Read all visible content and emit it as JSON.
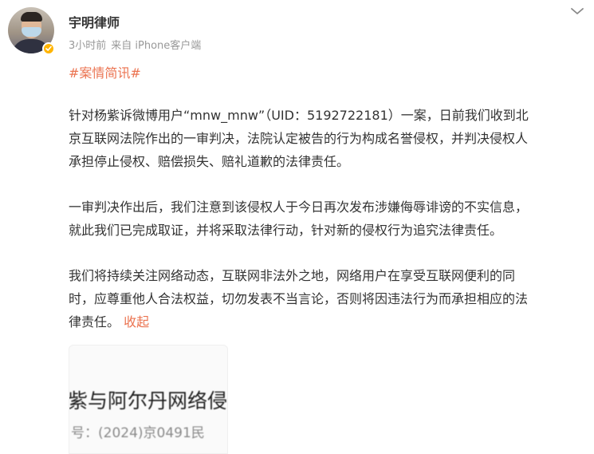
{
  "post": {
    "author": {
      "name": "宇明律师",
      "avatar_icon": "avatar",
      "verified_icon": "verified-badge-icon",
      "verified_color": "#ffb400"
    },
    "meta": {
      "time": "3小时前",
      "source": "来自 iPhone客户端"
    },
    "more_icon": "chevron-down-icon",
    "topic": "#案情简讯#",
    "paragraphs": {
      "p1": {
        "lines": [
          "针对杨紫诉微博用户“mnw_mnw”（UID：5192722181）一案，日前我们收到北",
          "京互联网法院作出的一审判决，法院认定被告的行为构成名誉侵权，并判决侵权人",
          "承担停止侵权、赔偿损失、赔礼道歉的法律责任。"
        ]
      },
      "p2": {
        "lines": [
          "一审判决作出后，我们注意到该侵权人于今日再次发布涉嫌侮辱诽谤的不实信息，",
          "就此我们已完成取证，并将采取法律行动，针对新的侵权行为追究法律责任。"
        ]
      },
      "p3": {
        "lines": [
          "我们将持续关注网络动态，互联网非法外之地，网络用户在享受互联网便利的同",
          "时，应尊重他人合法权益，切勿发表不当言论，否则将因违法行为而承担相应的法",
          "律责任。"
        ],
        "collapse_label": "收起"
      }
    },
    "image": {
      "line1": "紫与阿尔丹网络侵",
      "line2": "号：(2024)京0491民"
    },
    "colors": {
      "accent": "#eb7350",
      "text": "#333333",
      "meta": "#999999"
    }
  }
}
